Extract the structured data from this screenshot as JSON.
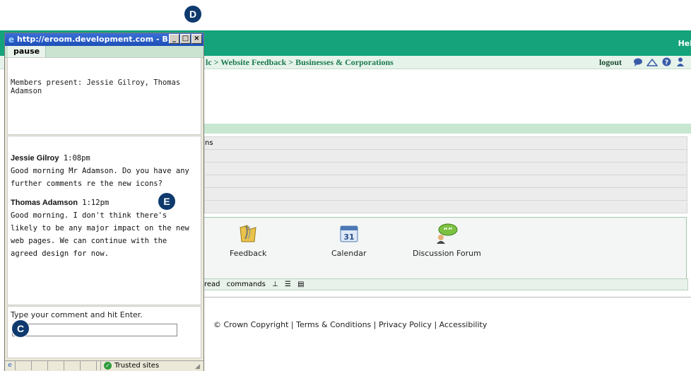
{
  "background": {
    "header_partial": "Hel",
    "breadcrumb": "lc > Website Feedback > Businesses & Corporations",
    "logout": "logout",
    "toolbar_icons": [
      "chat-icon",
      "edit-icon",
      "help-icon",
      "user-icon"
    ],
    "row_partial": "ns",
    "apps": [
      {
        "label": "Feedback",
        "icon": "feedback-icon"
      },
      {
        "label": "Calendar",
        "icon": "calendar-icon",
        "day": "31"
      },
      {
        "label": "Discussion Forum",
        "icon": "discussion-forum-icon"
      }
    ],
    "commands_bar": {
      "read": "read",
      "commands": "commands"
    },
    "footer": "© Crown Copyright | Terms & Conditions | Privacy Policy | Accessibility"
  },
  "popup": {
    "title": "http://eroom.development.com - B...",
    "pause_label": "pause",
    "members_text": "Members present: Jessie Gilroy, Thomas Adamson",
    "messages": [
      {
        "author": "Jessie Gilroy",
        "time": "1:08pm",
        "text": "Good morning Mr Adamson. Do you have any further comments re the new icons?"
      },
      {
        "author": "Thomas Adamson",
        "time": "1:12pm",
        "text": "Good morning. I don't think there's likely to be any major impact on the new web pages. We can continue with the agreed design for now."
      }
    ],
    "input_prompt": "Type your comment and hit Enter.",
    "input_value": "",
    "status_zone": "Trusted sites"
  },
  "callouts": {
    "c": "C",
    "d": "D",
    "e": "E"
  }
}
